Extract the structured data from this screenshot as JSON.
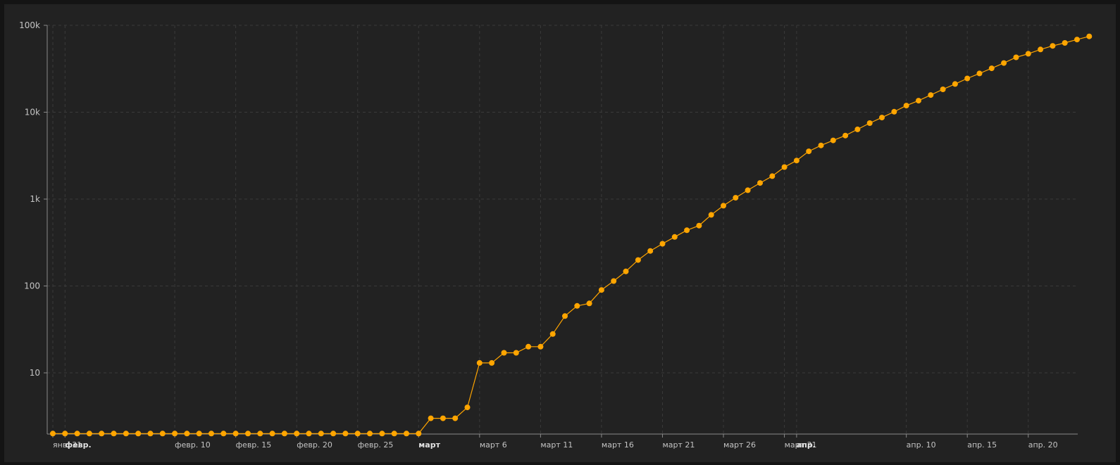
{
  "chart_data": {
    "type": "line",
    "scale_y": "log",
    "ylim": [
      1,
      100000
    ],
    "y_ticks": [
      {
        "value": 10,
        "label": "10"
      },
      {
        "value": 100,
        "label": "100"
      },
      {
        "value": 1000,
        "label": "1k"
      },
      {
        "value": 10000,
        "label": "10k"
      },
      {
        "value": 100000,
        "label": "100k"
      }
    ],
    "x_ticks": [
      {
        "date": "2020-01-31",
        "label": "янв. 31",
        "major": false
      },
      {
        "date": "2020-02-01",
        "label": "февр.",
        "major": true
      },
      {
        "date": "2020-02-10",
        "label": "февр. 10",
        "major": false
      },
      {
        "date": "2020-02-15",
        "label": "февр. 15",
        "major": false
      },
      {
        "date": "2020-02-20",
        "label": "февр. 20",
        "major": false
      },
      {
        "date": "2020-02-25",
        "label": "февр. 25",
        "major": false
      },
      {
        "date": "2020-03-01",
        "label": "март",
        "major": true
      },
      {
        "date": "2020-03-06",
        "label": "март 6",
        "major": false
      },
      {
        "date": "2020-03-11",
        "label": "март 11",
        "major": false
      },
      {
        "date": "2020-03-16",
        "label": "март 16",
        "major": false
      },
      {
        "date": "2020-03-21",
        "label": "март 21",
        "major": false
      },
      {
        "date": "2020-03-26",
        "label": "март 26",
        "major": false
      },
      {
        "date": "2020-03-31",
        "label": "март 31",
        "major": false
      },
      {
        "date": "2020-04-01",
        "label": "апр.",
        "major": true
      },
      {
        "date": "2020-04-10",
        "label": "апр. 10",
        "major": false
      },
      {
        "date": "2020-04-15",
        "label": "апр. 15",
        "major": false
      },
      {
        "date": "2020-04-20",
        "label": "апр. 20",
        "major": false
      }
    ],
    "grid": true,
    "legend": "none",
    "series": [
      {
        "color": "#ffa500",
        "x": [
          "2020-01-31",
          "2020-02-01",
          "2020-02-02",
          "2020-02-03",
          "2020-02-04",
          "2020-02-05",
          "2020-02-06",
          "2020-02-07",
          "2020-02-08",
          "2020-02-09",
          "2020-02-10",
          "2020-02-11",
          "2020-02-12",
          "2020-02-13",
          "2020-02-14",
          "2020-02-15",
          "2020-02-16",
          "2020-02-17",
          "2020-02-18",
          "2020-02-19",
          "2020-02-20",
          "2020-02-21",
          "2020-02-22",
          "2020-02-23",
          "2020-02-24",
          "2020-02-25",
          "2020-02-26",
          "2020-02-27",
          "2020-02-28",
          "2020-02-29",
          "2020-03-01",
          "2020-03-02",
          "2020-03-03",
          "2020-03-04",
          "2020-03-05",
          "2020-03-06",
          "2020-03-07",
          "2020-03-08",
          "2020-03-09",
          "2020-03-10",
          "2020-03-11",
          "2020-03-12",
          "2020-03-13",
          "2020-03-14",
          "2020-03-15",
          "2020-03-16",
          "2020-03-17",
          "2020-03-18",
          "2020-03-19",
          "2020-03-20",
          "2020-03-21",
          "2020-03-22",
          "2020-03-23",
          "2020-03-24",
          "2020-03-25",
          "2020-03-26",
          "2020-03-27",
          "2020-03-28",
          "2020-03-29",
          "2020-03-30",
          "2020-03-31",
          "2020-04-01",
          "2020-04-02",
          "2020-04-03",
          "2020-04-04",
          "2020-04-05",
          "2020-04-06",
          "2020-04-07",
          "2020-04-08",
          "2020-04-09",
          "2020-04-10",
          "2020-04-11",
          "2020-04-12",
          "2020-04-13",
          "2020-04-14",
          "2020-04-15",
          "2020-04-16",
          "2020-04-17",
          "2020-04-18",
          "2020-04-19",
          "2020-04-20",
          "2020-04-21",
          "2020-04-22",
          "2020-04-23",
          "2020-04-24",
          "2020-04-25"
        ],
        "y": [
          2,
          2,
          2,
          2,
          2,
          2,
          2,
          2,
          2,
          2,
          2,
          2,
          2,
          2,
          2,
          2,
          2,
          2,
          2,
          2,
          2,
          2,
          2,
          2,
          2,
          2,
          2,
          2,
          2,
          2,
          2,
          3,
          3,
          3,
          4,
          13,
          13,
          17,
          17,
          20,
          20,
          28,
          45,
          59,
          63,
          90,
          114,
          147,
          199,
          253,
          306,
          367,
          438,
          495,
          658,
          840,
          1036,
          1264,
          1534,
          1836,
          2337,
          2777,
          3548,
          4149,
          4731,
          5389,
          6343,
          7497,
          8672,
          10131,
          11917,
          13584,
          15770,
          18328,
          21102,
          24490,
          27938,
          32008,
          36793,
          42853,
          47121,
          52763,
          57999,
          62773,
          68622,
          74588
        ]
      }
    ]
  }
}
